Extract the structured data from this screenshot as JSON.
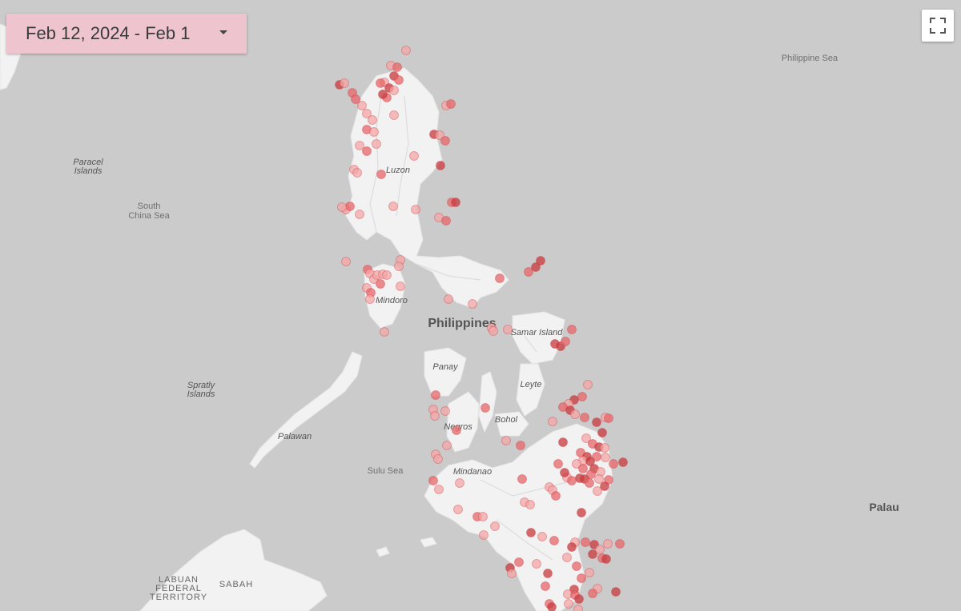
{
  "date_picker": {
    "label": "Feb 12, 2024 - Feb 1"
  },
  "fullscreen_button": {
    "icon": "fullscreen-icon"
  },
  "map_labels": {
    "philippine_sea": "Philippine Sea",
    "paracel_line1": "Paracel",
    "paracel_line2": "Islands",
    "south_china_sea_line1": "South",
    "south_china_sea_line2": "China Sea",
    "luzon": "Luzon",
    "mindoro": "Mindoro",
    "philippines": "Philippines",
    "samar": "Samar Island",
    "panay": "Panay",
    "leyte": "Leyte",
    "bohol": "Bohol",
    "negros": "Negros",
    "spratly_line1": "Spratly",
    "spratly_line2": "Islands",
    "palawan": "Palawan",
    "sulu_sea": "Sulu Sea",
    "mindanao": "Mindanao",
    "palau": "Palau",
    "labuan_line1": "LABUAN",
    "labuan_line2": "FEDERAL",
    "labuan_line3": "TERRITORY",
    "sabah": "SABAH"
  },
  "colors": {
    "water": "#cbcbcb",
    "land": "#f2f2f2",
    "marker_light": "#f4a6a6",
    "marker_mid": "#e8676a",
    "marker_dark": "#c8393e",
    "date_picker_bg": "#eec4cf"
  },
  "markers": [
    {
      "id": "luzon-north",
      "count": 14,
      "intensity": "mid"
    },
    {
      "id": "luzon-west",
      "count": 16,
      "intensity": "light"
    },
    {
      "id": "luzon-east",
      "count": 9,
      "intensity": "mid"
    },
    {
      "id": "central-luzon",
      "count": 8,
      "intensity": "light"
    },
    {
      "id": "bicol-sea",
      "count": 3,
      "intensity": "dark"
    },
    {
      "id": "mindoro",
      "count": 15,
      "intensity": "light"
    },
    {
      "id": "visayas",
      "count": 14,
      "intensity": "light"
    },
    {
      "id": "samar",
      "count": 4,
      "intensity": "dark"
    },
    {
      "id": "mindanao-east",
      "count": 42,
      "intensity": "mid"
    },
    {
      "id": "mindanao-west",
      "count": 12,
      "intensity": "light"
    },
    {
      "id": "mindanao-south",
      "count": 28,
      "intensity": "mid"
    }
  ]
}
